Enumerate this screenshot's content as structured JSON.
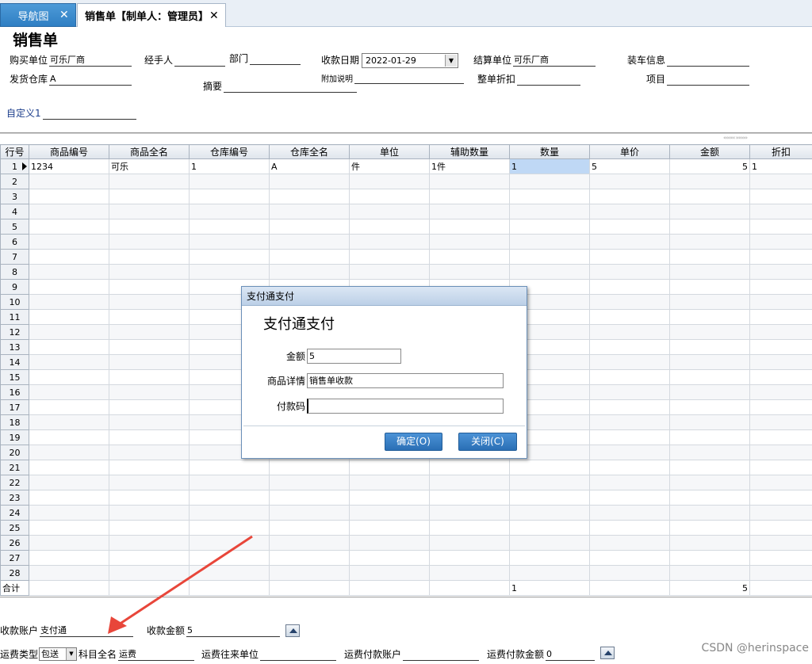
{
  "tabs": [
    {
      "label": "导航图",
      "close": "✕"
    },
    {
      "label": "销售单【制单人：管理员】",
      "close": "✕"
    }
  ],
  "page_title": "销售单",
  "header": {
    "buyer_label": "购买单位",
    "buyer_value": "可乐厂商",
    "handler_label": "经手人",
    "handler_value": "",
    "dept_label": "部门",
    "dept_value": "",
    "date_label": "收款日期",
    "date_value": "2022-01-29",
    "settle_label": "结算单位",
    "settle_value": "可乐厂商",
    "loading_label": "装车信息",
    "loading_value": "",
    "warehouse_label": "发货仓库",
    "warehouse_value": "A",
    "note_label": "附加说明",
    "note_value": "",
    "discount_label": "整单折扣",
    "discount_value": "",
    "project_label": "项目",
    "project_value": "",
    "summary_label": "摘要",
    "summary_value": "",
    "custom_label": "自定义1",
    "custom_value": ""
  },
  "grid": {
    "columns": [
      "行号",
      "商品编号",
      "商品全名",
      "仓库编号",
      "仓库全名",
      "单位",
      "辅助数量",
      "数量",
      "单价",
      "金额",
      "折扣"
    ],
    "rows": [
      [
        "1",
        "1234",
        "可乐",
        "1",
        "A",
        "件",
        "1件",
        "1",
        "5",
        "5",
        "1"
      ],
      [
        "2"
      ],
      [
        "3"
      ],
      [
        "4"
      ],
      [
        "5"
      ],
      [
        "6"
      ],
      [
        "7"
      ],
      [
        "8"
      ],
      [
        "9"
      ],
      [
        "10"
      ],
      [
        "11"
      ],
      [
        "12"
      ],
      [
        "13"
      ],
      [
        "14"
      ],
      [
        "15"
      ],
      [
        "16"
      ],
      [
        "17"
      ],
      [
        "18"
      ],
      [
        "19"
      ],
      [
        "20"
      ],
      [
        "21"
      ],
      [
        "22"
      ],
      [
        "23"
      ],
      [
        "24"
      ],
      [
        "25"
      ],
      [
        "26"
      ],
      [
        "27"
      ],
      [
        "28"
      ]
    ],
    "total_label": "合计",
    "total_qty": "1",
    "total_amount": "5"
  },
  "dialog": {
    "title": "支付通支付",
    "heading": "支付通支付",
    "amount_label": "金额",
    "amount_value": "5",
    "detail_label": "商品详情",
    "detail_value": "销售单收款",
    "code_label": "付款码",
    "code_value": "",
    "ok_label": "确定(O)",
    "close_label": "关闭(C)"
  },
  "footer": {
    "account_label": "收款账户",
    "account_value": "支付通",
    "amount_label": "收款金额",
    "amount_value": "5",
    "freight_type_label": "运费类型",
    "freight_type_value": "包送",
    "subject_label": "科目全名",
    "subject_value": "运费",
    "freight_unit_label": "运费往来单位",
    "freight_unit_value": "",
    "freight_account_label": "运费付款账户",
    "freight_account_value": "",
    "freight_amount_label": "运费付款金额",
    "freight_amount_value": "0"
  },
  "watermark": "CSDN @herinspace",
  "colors": {
    "accent": "#2f7fc3",
    "selection": "#bfd8f5",
    "arrow": "#e8463a"
  }
}
